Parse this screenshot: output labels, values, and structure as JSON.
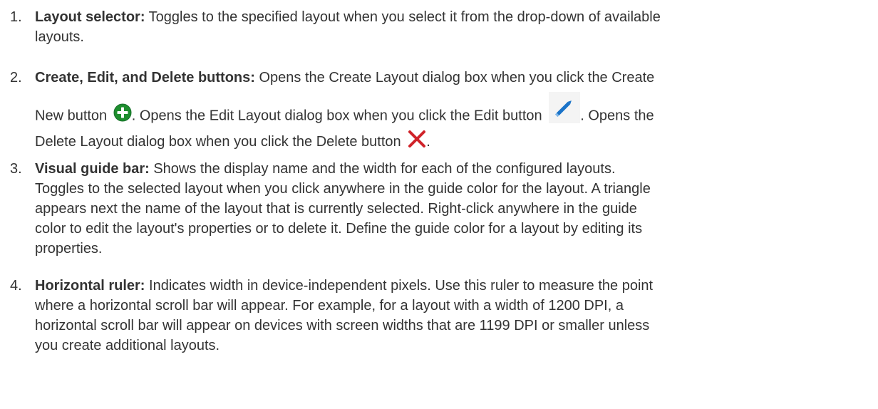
{
  "items": [
    {
      "number": "1.",
      "term": "Layout selector:",
      "lines": [
        " Toggles to the specified layout when you select it from the drop-down of available",
        "layouts."
      ]
    },
    {
      "number": "2.",
      "term": "Create, Edit, and Delete buttons:",
      "lead": " Opens the Create Layout dialog box when you click the Create",
      "line2_a": "New button ",
      "line2_b": ". Opens the Edit Layout dialog box when you click the Edit button ",
      "line2_c": ". Opens the",
      "line3_a": "Delete Layout dialog box when you click the Delete button ",
      "line3_b": ".",
      "icons": {
        "create": "plus-circle-icon",
        "edit": "pencil-icon",
        "delete": "x-icon",
        "create_color": "#1e8e2e",
        "edit_color": "#1a73c8",
        "delete_color": "#d0232a"
      }
    },
    {
      "number": "3.",
      "term": "Visual guide bar:",
      "lines": [
        " Shows the display name and the width for each of the configured layouts.",
        "Toggles to the selected layout when you click anywhere in the guide color for the layout. A triangle",
        "appears next the name of the layout that is currently selected. Right-click anywhere in the guide",
        "color to edit the layout's properties or to delete it. Define the guide color for a layout by editing its",
        "properties."
      ]
    },
    {
      "number": "4.",
      "term": "Horizontal ruler:",
      "lines": [
        " Indicates width in device-independent pixels. Use this ruler to measure the point",
        "where a horizontal scroll bar will appear. For example, for a layout with a width of 1200 DPI, a",
        "horizontal scroll bar will appear on devices with screen widths that are 1199 DPI or smaller unless",
        "you create additional layouts."
      ]
    }
  ]
}
